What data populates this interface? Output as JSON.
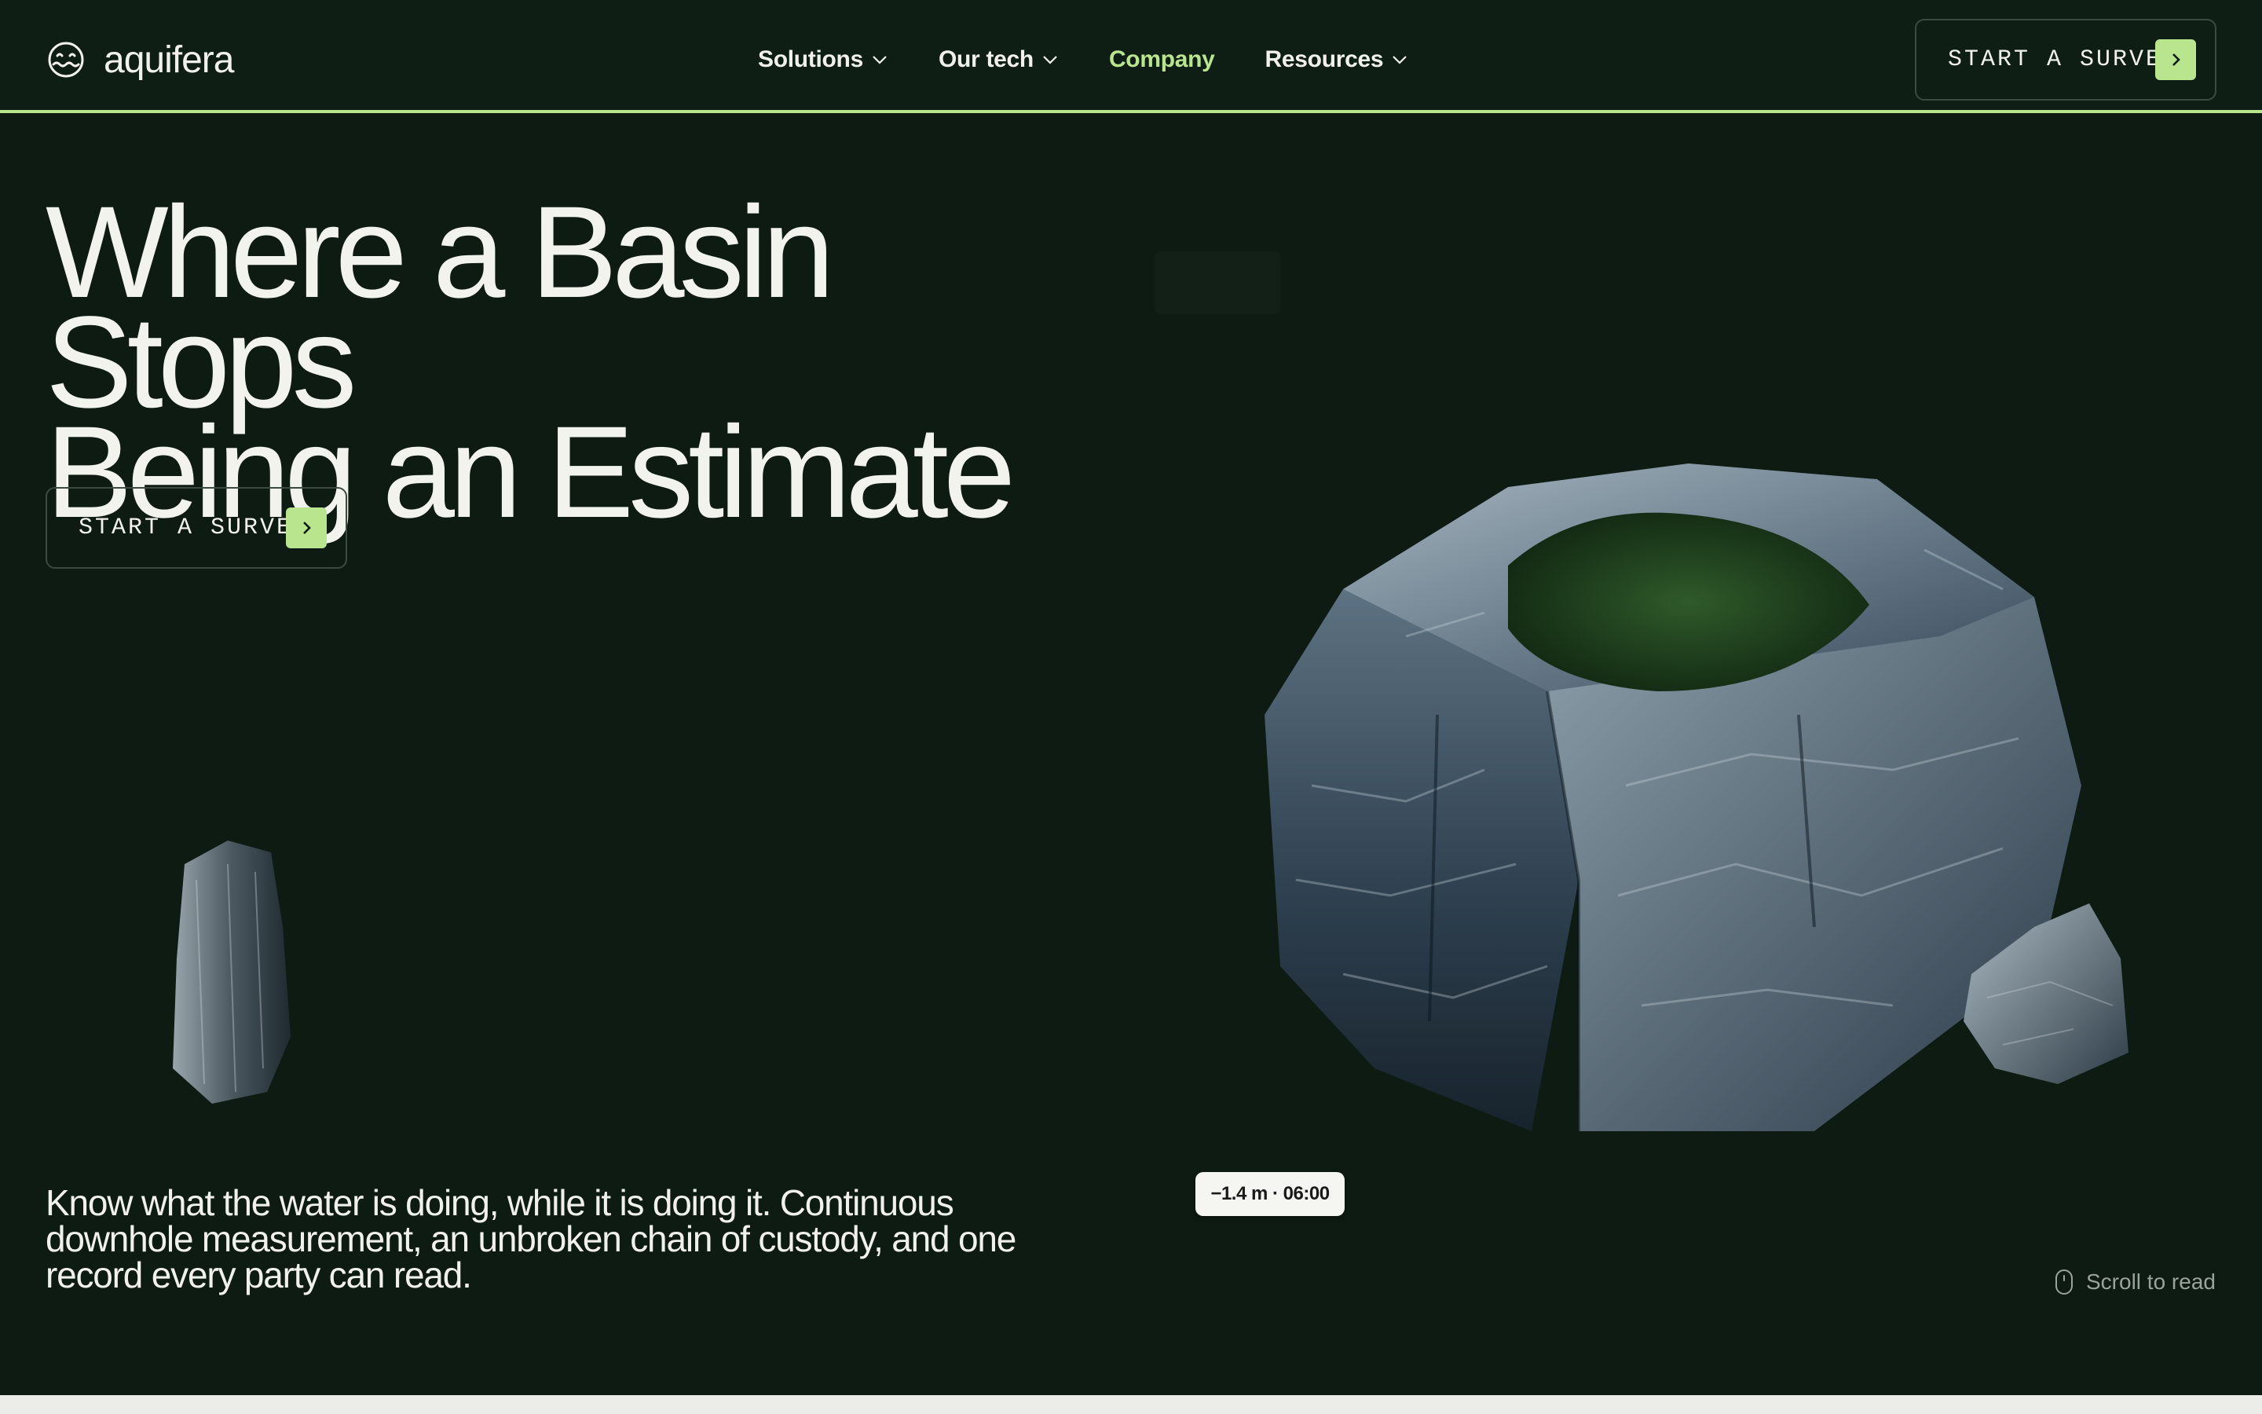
{
  "brand": {
    "name": "aquifera",
    "logo_icon": "smile-wave-logo-icon"
  },
  "nav": {
    "items": [
      {
        "label": "Solutions",
        "has_dropdown": true
      },
      {
        "label": "Our tech",
        "has_dropdown": true
      },
      {
        "label": "Company",
        "has_dropdown": false,
        "active": true
      },
      {
        "label": "Resources",
        "has_dropdown": true
      }
    ]
  },
  "header_cta": {
    "label": "START A SURVEY",
    "icon": "chevron-right-icon"
  },
  "hero": {
    "title_line1": "Where a Basin Stops",
    "title_line2": "Being an Estimate",
    "cta_label": "START A SURVEY",
    "subcopy": "Know what the water is doing, while it is doing it. Continuous downhole measurement, an unbroken chain of custody, and one record every party can read."
  },
  "depth_tag": {
    "label": "−1.4 m · 06:00"
  },
  "scroll_hint": {
    "label": "Scroll to read",
    "icon": "mouse-icon"
  },
  "colors": {
    "background": "#0d1b12",
    "accent": "#b9e58f",
    "text": "#f1f1ec",
    "muted": "#9aa39c"
  }
}
